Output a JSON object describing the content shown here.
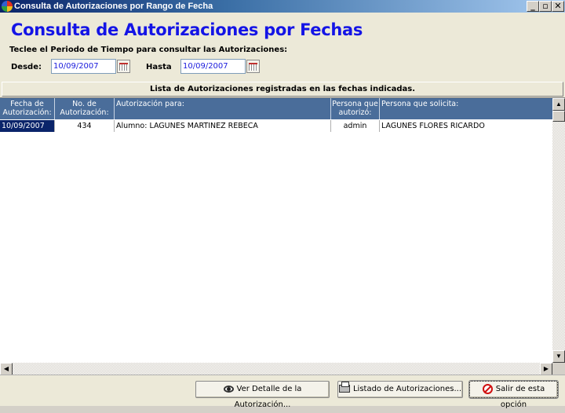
{
  "window": {
    "title": "Consulta de Autorizaciones por Rango de Fecha",
    "controls": {
      "minimize": "_",
      "maximize": "▫",
      "close": "✕"
    }
  },
  "header": {
    "heading": "Consulta de Autorizaciones por Fechas",
    "instruction": "Teclee el Periodo de Tiempo para consultar las Autorizaciones:"
  },
  "filters": {
    "desde_label": "Desde:",
    "desde_value": "10/09/2007",
    "hasta_label": "Hasta",
    "hasta_value": "10/09/2007"
  },
  "list": {
    "caption": "Lista de Autorizaciones registradas en las fechas indicadas.",
    "columns": [
      {
        "line1": "Fecha de",
        "line2": "Autorización:"
      },
      {
        "line1": "No. de",
        "line2": "Autorización:"
      },
      {
        "line1": "Autorización para:",
        "line2": ""
      },
      {
        "line1": "Persona que",
        "line2": "autorizó:"
      },
      {
        "line1": "Persona que solicita:",
        "line2": ""
      }
    ],
    "rows": [
      {
        "fecha": "10/09/2007",
        "numero": "434",
        "para": "Alumno: LAGUNES MARTINEZ REBECA",
        "autorizo": "admin",
        "solicita": "LAGUNES FLORES RICARDO"
      }
    ]
  },
  "buttons": {
    "detalle": "Ver Detalle de la Autorización...",
    "listado": "Listado de Autorizaciones...",
    "salir": "Salir de esta opción"
  },
  "icons": {
    "app": "app-logo-icon",
    "calendar": "calendar-icon",
    "detalle": "eye-icon",
    "listado": "printer-icon",
    "salir": "stop-icon"
  },
  "colors": {
    "heading": "#1414e6",
    "grid_header": "#4a6d9a",
    "selection": "#0a246a"
  }
}
